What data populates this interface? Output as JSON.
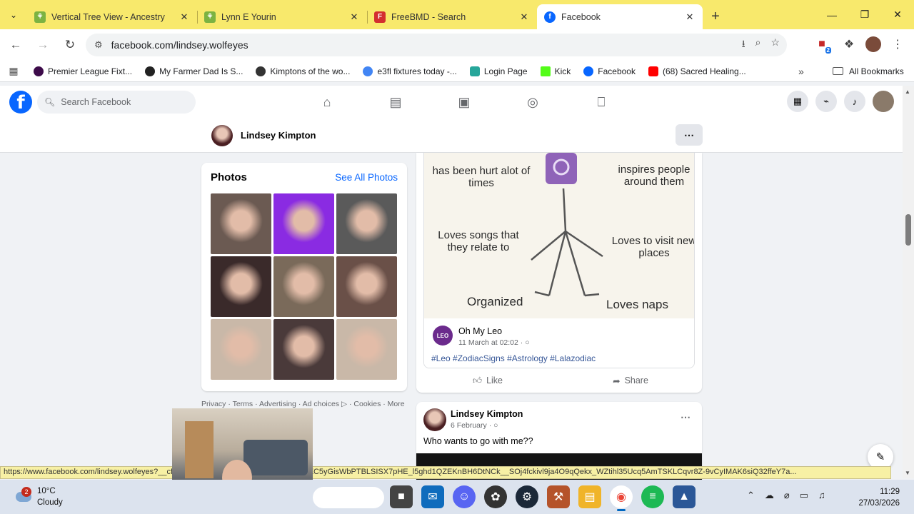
{
  "browser": {
    "tabs": [
      {
        "title": "Vertical Tree View - Ancestry",
        "favicon_color": "#7cb342"
      },
      {
        "title": "Lynn E Yourin",
        "favicon_color": "#7cb342"
      },
      {
        "title": "FreeBMD - Search",
        "favicon_color": "#d32f2f"
      },
      {
        "title": "Facebook",
        "favicon_color": "#0866ff"
      }
    ],
    "active_tab_index": 3,
    "url": "facebook.com/lindsey.wolfeyes",
    "bookmarks": [
      {
        "label": "Premier League Fixt...",
        "color": "#3d0b4a"
      },
      {
        "label": "My Farmer Dad Is S...",
        "color": "#222222"
      },
      {
        "label": "Kimptons of the wo...",
        "color": "#333333"
      },
      {
        "label": "e3fl fixtures today -...",
        "color": "#4285f4"
      },
      {
        "label": "Login Page",
        "color": "#26a69a"
      },
      {
        "label": "Kick",
        "color": "#53fc18"
      },
      {
        "label": "Facebook",
        "color": "#0866ff"
      },
      {
        "label": "(68) Sacred Healing...",
        "color": "#ff0000"
      }
    ],
    "all_bookmarks": "All Bookmarks",
    "extension_badge": "2",
    "status_url": "https://www.facebook.com/lindsey.wolfeyes?__cft__[0]=AZUVXhl6-xPd-YAQDBM8KmMZC5yGisWbPTBLSISX7pHE_l5ghd1QZEKnBH6DtNCk__SOj4fckivl9ja4O9qQekx_WZtihl35Ucq5AmTSKLCqvr8Z-9vCyIMAK6siQ32ffeY7a..."
  },
  "facebook": {
    "search_placeholder": "Search Facebook",
    "profile_name": "Lindsey Kimpton",
    "photos": {
      "heading": "Photos",
      "see_all": "See All Photos",
      "thumbnail_colors": [
        "#6b5a52",
        "#8a2be2",
        "#5a5a5a",
        "#3a2a2a",
        "#7a6a5a",
        "#6a5048",
        "#c9b8a8",
        "#4a3a3a",
        "#c9b8a8"
      ]
    },
    "footer_links": [
      "Privacy",
      "Terms",
      "Advertising",
      "Ad choices",
      "Cookies",
      "More"
    ],
    "post1": {
      "meme_texts": {
        "top_left": "has been hurt alot of times",
        "top_right": "inspires people around them",
        "mid_left": "Loves songs that they relate to",
        "mid_right": "Loves to visit new places",
        "bottom_left": "Organized",
        "bottom_right": "Loves naps"
      },
      "source_name": "Oh My Leo",
      "source_date": "11 March at 02:02 ·",
      "hashtags": "#Leo  #ZodiacSigns #Astrology #Lalazodiac",
      "like": "Like",
      "share": "Share"
    },
    "post2": {
      "author": "Lindsey Kimpton",
      "date": "6 February ·",
      "text": "Who wants to go with me??"
    }
  },
  "taskbar": {
    "weather_badge": "2",
    "temperature": "10°C",
    "condition": "Cloudy",
    "time": "11:29",
    "date": "27/03/2026"
  }
}
